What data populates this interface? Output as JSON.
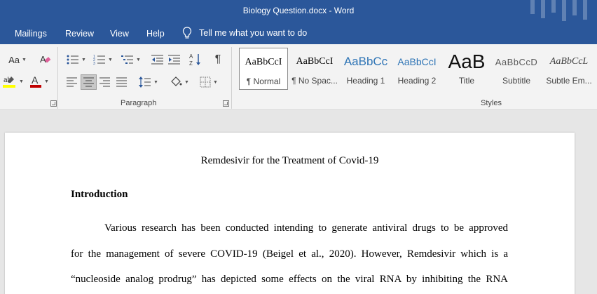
{
  "titlebar": {
    "title": "Biology Question.docx  -  Word"
  },
  "menu": {
    "mailings": "Mailings",
    "review": "Review",
    "view": "View",
    "help": "Help",
    "tell_me": "Tell me what you want to do"
  },
  "ribbon": {
    "font_case": "Aa",
    "paragraph_label": "Paragraph",
    "styles_label": "Styles",
    "styles": [
      {
        "sample": "AaBbCcI",
        "name": "¶ Normal",
        "selected": true
      },
      {
        "sample": "AaBbCcI",
        "name": "¶ No Spac..."
      },
      {
        "sample": "AaBbCc",
        "name": "Heading 1"
      },
      {
        "sample": "AaBbCcI",
        "name": "Heading 2"
      },
      {
        "sample": "AaB",
        "name": "Title"
      },
      {
        "sample": "AaBbCcD",
        "name": "Subtitle"
      },
      {
        "sample": "AaBbCcL",
        "name": "Subtle Em..."
      }
    ],
    "colors": {
      "highlight": "#ffff00",
      "font_color": "#c00000",
      "accent": "#2b579a"
    }
  },
  "document": {
    "title": "Remdesivir for the Treatment of Covid-19",
    "heading": "Introduction",
    "lines": [
      "Various research has been conducted intending to generate antiviral drugs to be approved",
      "for the management of severe COVID-19 (Beigel et al., 2020). However, Remdesivir which is a",
      "“nucleoside analog prodrug” has depicted some effects on the viral RNA by inhibiting the RNA"
    ]
  }
}
